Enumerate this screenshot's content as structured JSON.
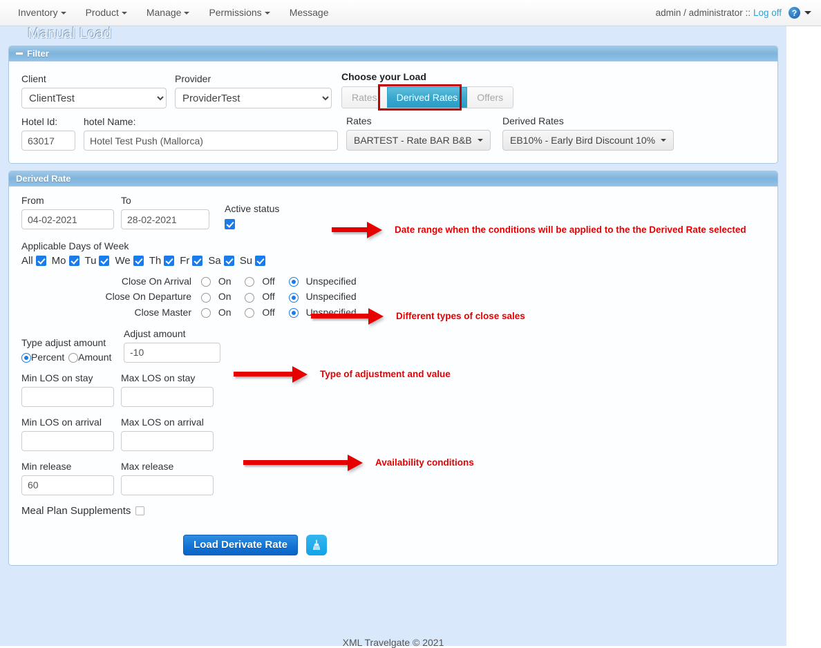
{
  "navbar": {
    "items": [
      {
        "label": "Inventory",
        "has_caret": true
      },
      {
        "label": "Product",
        "has_caret": true
      },
      {
        "label": "Manage",
        "has_caret": true
      },
      {
        "label": "Permissions",
        "has_caret": true
      },
      {
        "label": "Message",
        "has_caret": false
      }
    ],
    "user_text": "admin / administrator ::",
    "logoff_label": "Log off",
    "help_icon": "question-mark-icon",
    "help_glyph": "?"
  },
  "page": {
    "title": "Manual Load",
    "footer": "XML Travelgate © 2021"
  },
  "filter": {
    "panel_title": "Filter",
    "client_label": "Client",
    "client_value": "ClientTest",
    "provider_label": "Provider",
    "provider_value": "ProviderTest",
    "choose_label": "Choose your Load",
    "load_buttons": [
      {
        "label": "Rates",
        "active": false
      },
      {
        "label": "Derived Rates",
        "active": true
      },
      {
        "label": "Offers",
        "active": false
      }
    ],
    "hotel_id_label": "Hotel Id:",
    "hotel_id_value": "63017",
    "hotel_name_label": "hotel Name:",
    "hotel_name_value": "Hotel Test Push (Mallorca)",
    "rates_label": "Rates",
    "rates_value": "BARTEST - Rate BAR B&B",
    "derived_rates_label": "Derived Rates",
    "derived_rates_value": "EB10% - Early Bird Discount 10%"
  },
  "derived_rate": {
    "panel_title": "Derived Rate",
    "from_label": "From",
    "from_value": "04-02-2021",
    "to_label": "To",
    "to_value": "28-02-2021",
    "active_status_label": "Active status",
    "active_status_checked": true,
    "days_label": "Applicable Days of Week",
    "days": [
      {
        "label": "All",
        "checked": true
      },
      {
        "label": "Mo",
        "checked": true
      },
      {
        "label": "Tu",
        "checked": true
      },
      {
        "label": "We",
        "checked": true
      },
      {
        "label": "Th",
        "checked": true
      },
      {
        "label": "Fr",
        "checked": true
      },
      {
        "label": "Sa",
        "checked": true
      },
      {
        "label": "Su",
        "checked": true
      }
    ],
    "close_options": [
      "On",
      "Off",
      "Unspecified"
    ],
    "close_rows": [
      {
        "name": "Close On Arrival",
        "selected": "Unspecified"
      },
      {
        "name": "Close On Departure",
        "selected": "Unspecified"
      },
      {
        "name": "Close Master",
        "selected": "Unspecified"
      }
    ],
    "type_adjust_label": "Type adjust amount",
    "type_adjust_options": [
      {
        "label": "Percent",
        "selected": true
      },
      {
        "label": "Amount",
        "selected": false
      }
    ],
    "adjust_amount_label": "Adjust amount",
    "adjust_amount_value": "-10",
    "min_los_stay_label": "Min LOS on stay",
    "min_los_stay_value": "",
    "max_los_stay_label": "Max LOS on stay",
    "max_los_stay_value": "",
    "min_los_arrival_label": "Min LOS on arrival",
    "min_los_arrival_value": "",
    "max_los_arrival_label": "Max LOS on arrival",
    "max_los_arrival_value": "",
    "min_release_label": "Min release",
    "min_release_value": "60",
    "max_release_label": "Max release",
    "max_release_value": "",
    "meal_plan_label": "Meal Plan Supplements",
    "meal_plan_checked": false,
    "submit_label": "Load Derivate Rate",
    "clear_icon": "broom-icon"
  },
  "annotations": [
    {
      "text": "Date range when the conditions will be applied to the the Derived Rate selected"
    },
    {
      "text": "Different types of close sales"
    },
    {
      "text": "Type of adjustment and value"
    },
    {
      "text": "Availability conditions"
    }
  ],
  "colors": {
    "accent_blue": "#1272d4",
    "panel_header": "#7fb4dc",
    "page_bg": "#d9e9fb",
    "annotation_red": "#e60000",
    "highlight_box": "#c00000",
    "active_tab": "#2a9cc6"
  }
}
